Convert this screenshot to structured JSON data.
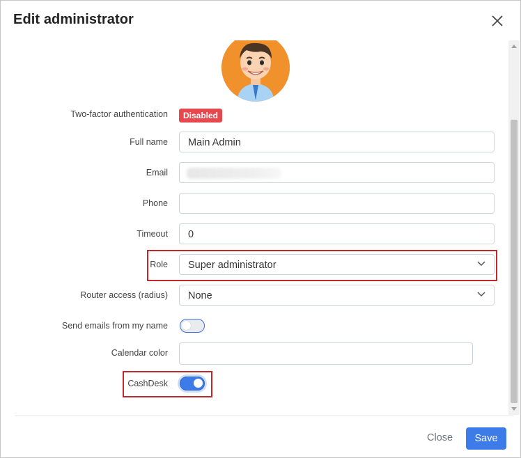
{
  "dialog": {
    "title": "Edit administrator",
    "close_icon": "close-icon"
  },
  "form": {
    "two_factor": {
      "label": "Two-factor authentication",
      "status": "Disabled",
      "status_color": "#e5484d"
    },
    "full_name": {
      "label": "Full name",
      "value": "Main Admin"
    },
    "email": {
      "label": "Email",
      "value": ""
    },
    "phone": {
      "label": "Phone",
      "value": ""
    },
    "timeout": {
      "label": "Timeout",
      "value": "0"
    },
    "role": {
      "label": "Role",
      "value": "Super administrator"
    },
    "router_access": {
      "label": "Router access (radius)",
      "value": "None"
    },
    "send_emails": {
      "label": "Send emails from my name",
      "enabled": false
    },
    "calendar_color": {
      "label": "Calendar color",
      "value": ""
    },
    "cashdesk": {
      "label": "CashDesk",
      "enabled": true
    }
  },
  "footer": {
    "close_label": "Close",
    "save_label": "Save"
  },
  "colors": {
    "accent": "#3d7be8",
    "highlight": "#c0282c"
  }
}
